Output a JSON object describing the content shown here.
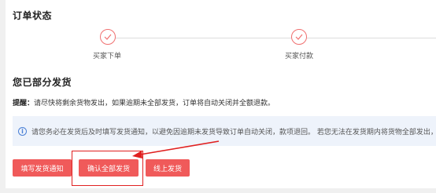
{
  "order_status": {
    "title": "订单状态",
    "steps": [
      {
        "label": "买家下单",
        "icon": "check-icon"
      },
      {
        "label": "买家付款",
        "icon": "check-icon"
      }
    ]
  },
  "shipment": {
    "title": "您已部分发货",
    "tip_prefix": "提醒：",
    "tip_text": "请尽快将剩余货物发出，如果逾期未全部发货，订单将自动关闭并全额退款。"
  },
  "notice": {
    "icon": "info-icon",
    "text": "请您务必在发货后及时填写发货通知，以避免因逾期未发货导致订单自动关闭，款项退回。 若您无法在发货期内将货物全部发出，您"
  },
  "actions": {
    "fill_notice": "填写发货通知",
    "confirm_all": "确认全部发货",
    "online_ship": "线上发货"
  },
  "colors": {
    "accent": "#f05a5a",
    "annotation": "#e02020",
    "notice_bg": "#eef3fb"
  }
}
